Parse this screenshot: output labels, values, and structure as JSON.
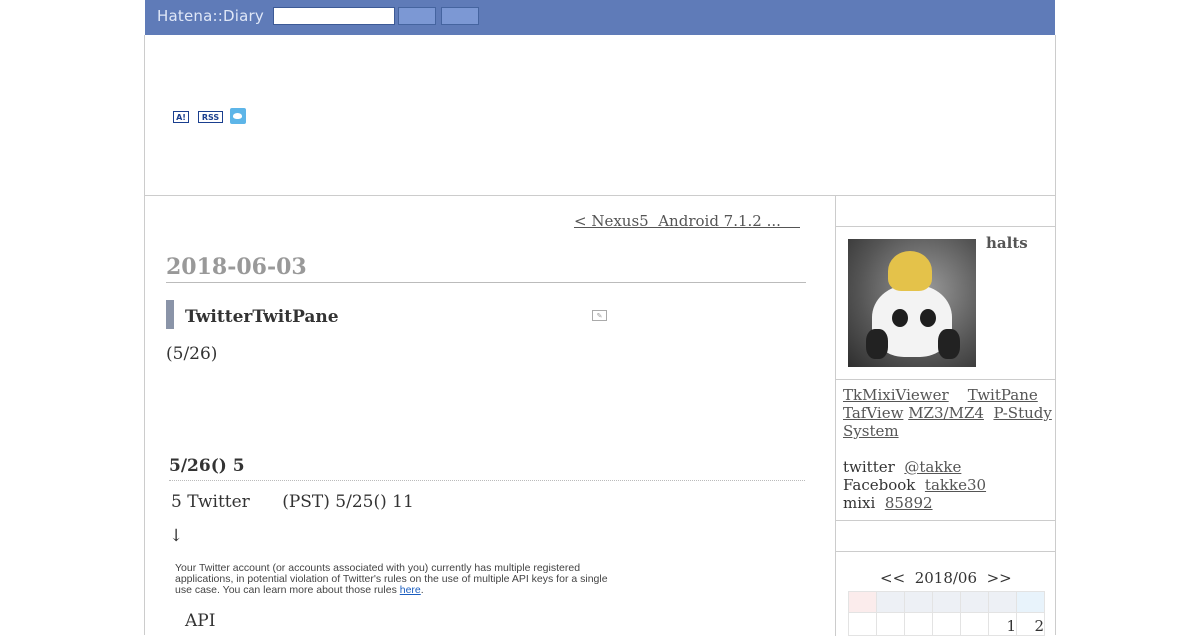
{
  "topbar": {
    "brand": "Hatena::Diary",
    "search_placeholder": "",
    "colors": {
      "bar": "#5f7bb8",
      "button": "#7c98d4"
    }
  },
  "header": {
    "icons": [
      "antenna-icon",
      "rss-icon",
      "twitter-icon"
    ],
    "antenna_label": "A!",
    "rss_label": "RSS"
  },
  "main": {
    "prev_link": "< Nexus5  Android 7.1.2 ...    ",
    "date": "2018-06-03",
    "entry_title": "TwitterTwitPane",
    "entry_date": "(5/26)",
    "section_heading": "5/26()  5",
    "para1": "5 Twitter      (PST) 5/25() 11",
    "arrow": "↓",
    "quote_text": "Your Twitter account (or accounts associated with you) currently has multiple registered applications, in potential violation of Twitter's rules on the use of multiple API keys for a single use case. You can learn more about those rules ",
    "quote_link": "here",
    "quote_end": ".",
    "api_text": "API"
  },
  "sidebar": {
    "username": "halts",
    "apps_line1_a": "TkMixiViewer",
    "apps_line1_b": "TwitPane",
    "apps_line2_a": "TafView",
    "apps_line2_b": "MZ3/MZ4",
    "apps_line2_c": "P-Study",
    "apps_line3": "System",
    "twitter_label": "twitter",
    "twitter_handle": "@takke",
    "facebook_label": "Facebook",
    "facebook_handle": "takke30",
    "mixi_label": "mixi",
    "mixi_id": "85892",
    "calendar": {
      "prev": "<<",
      "month": "2018/06",
      "next": ">>",
      "first_week": [
        "",
        "",
        "",
        "",
        "",
        "1",
        "2"
      ]
    }
  }
}
